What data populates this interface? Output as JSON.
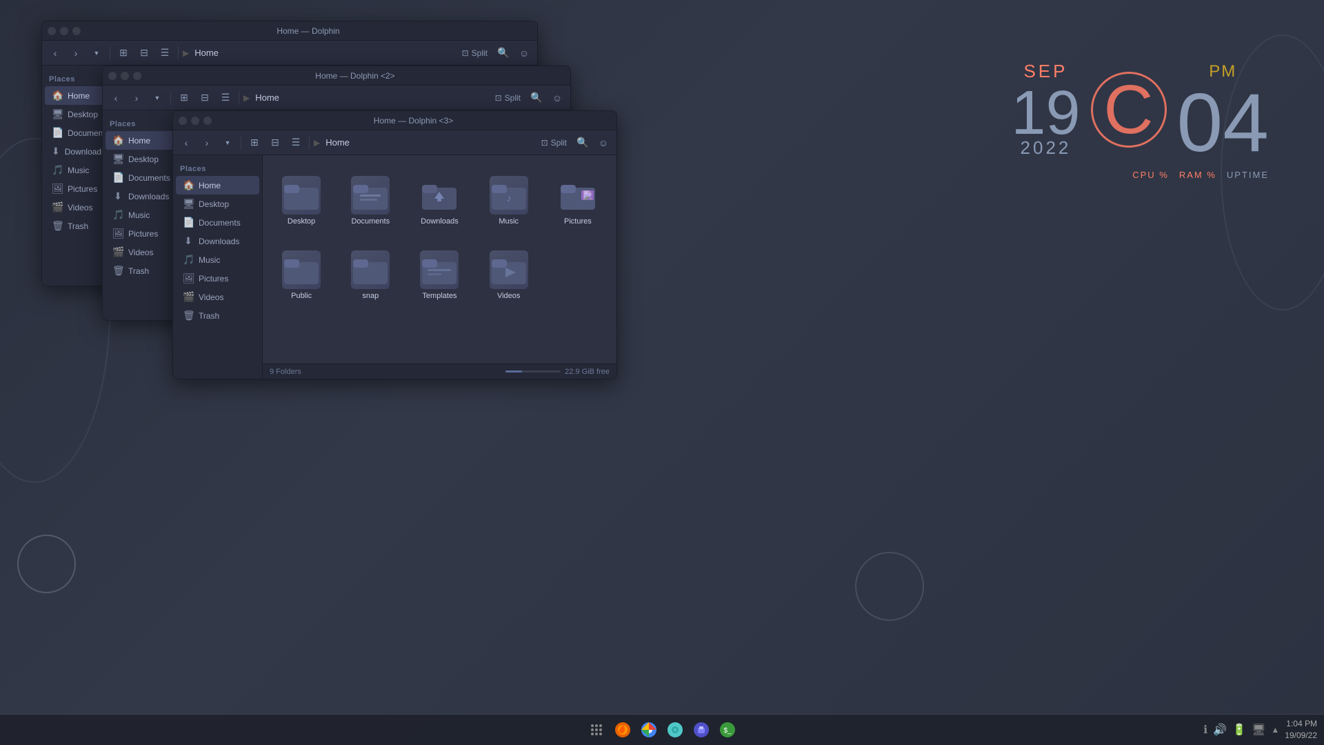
{
  "desktop": {
    "background": "#2e3440"
  },
  "clock": {
    "month": "SEP",
    "day": "19",
    "year": "2022",
    "hour": "04",
    "pm": "PM",
    "stats": "CPU % RAM % UPTIME"
  },
  "dolphin1": {
    "title": "Home — Dolphin",
    "path": "Home",
    "places_label": "Places",
    "sidebar_items": [
      {
        "id": "home",
        "label": "Home",
        "active": true
      },
      {
        "id": "desktop",
        "label": "Desktop"
      },
      {
        "id": "documents",
        "label": "Documents"
      },
      {
        "id": "downloads",
        "label": "Downloads"
      },
      {
        "id": "music",
        "label": "Music"
      },
      {
        "id": "pictures",
        "label": "Pictures"
      },
      {
        "id": "videos",
        "label": "Videos"
      },
      {
        "id": "trash",
        "label": "Trash"
      }
    ],
    "split_label": "Split"
  },
  "dolphin2": {
    "title": "Home — Dolphin <2>",
    "path": "Home",
    "places_label": "Places",
    "sidebar_items": [
      {
        "id": "home",
        "label": "Home",
        "active": true
      },
      {
        "id": "desktop",
        "label": "Desktop"
      },
      {
        "id": "documents",
        "label": "Documents"
      },
      {
        "id": "downloads",
        "label": "Downloads"
      },
      {
        "id": "music",
        "label": "Music"
      },
      {
        "id": "pictures",
        "label": "Pictures"
      },
      {
        "id": "videos",
        "label": "Videos"
      },
      {
        "id": "trash",
        "label": "Trash"
      }
    ],
    "split_label": "Split"
  },
  "dolphin3": {
    "title": "Home — Dolphin <3>",
    "path": "Home",
    "places_label": "Places",
    "sidebar_items": [
      {
        "id": "home",
        "label": "Home",
        "active": true
      },
      {
        "id": "desktop",
        "label": "Desktop"
      },
      {
        "id": "documents",
        "label": "Documents"
      },
      {
        "id": "downloads",
        "label": "Downloads"
      },
      {
        "id": "music",
        "label": "Music"
      },
      {
        "id": "pictures",
        "label": "Pictures"
      },
      {
        "id": "videos",
        "label": "Videos"
      },
      {
        "id": "trash",
        "label": "Trash"
      }
    ],
    "split_label": "Split",
    "files": [
      {
        "id": "desktop",
        "label": "Desktop",
        "icon": "folder"
      },
      {
        "id": "documents",
        "label": "Documents",
        "icon": "folder"
      },
      {
        "id": "downloads",
        "label": "Downloads",
        "icon": "folder-dl"
      },
      {
        "id": "music",
        "label": "Music",
        "icon": "folder"
      },
      {
        "id": "pictures",
        "label": "Pictures",
        "icon": "folder-pic"
      },
      {
        "id": "public",
        "label": "Public",
        "icon": "folder"
      },
      {
        "id": "snap",
        "label": "snap",
        "icon": "folder"
      },
      {
        "id": "templates",
        "label": "Templates",
        "icon": "folder"
      },
      {
        "id": "videos",
        "label": "Videos",
        "icon": "folder"
      }
    ],
    "status_folders": "9 Folders",
    "status_free": "22.9 GiB free"
  },
  "taskbar": {
    "time": "1:04 PM",
    "date": "19/09/22",
    "apps": [
      "grid",
      "firefox",
      "chrome",
      "settings",
      "store",
      "terminal"
    ]
  }
}
